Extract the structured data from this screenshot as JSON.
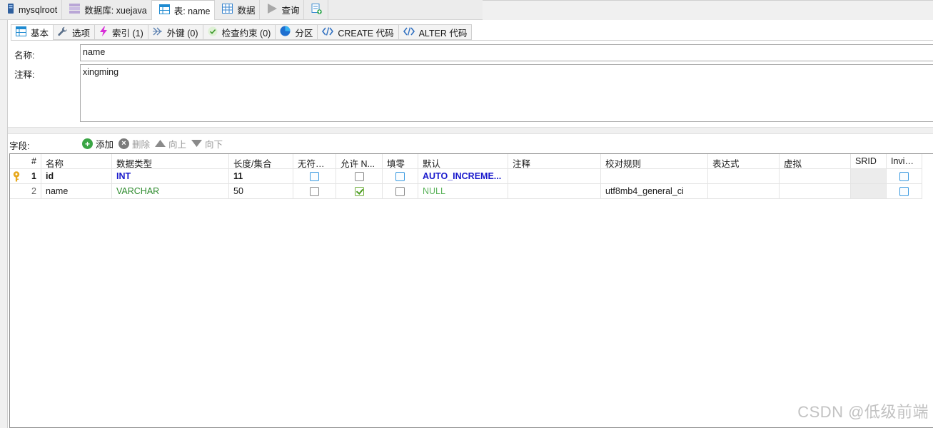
{
  "top_tabs": [
    {
      "label": "mysqlroot",
      "icon": "server-icon"
    },
    {
      "label": "数据库: xuejava",
      "icon": "database-icon"
    },
    {
      "label": "表: name",
      "icon": "table-icon",
      "active": true
    },
    {
      "label": "数据",
      "icon": "grid-icon"
    },
    {
      "label": "查询",
      "icon": "play-icon"
    },
    {
      "label": "",
      "icon": "new-query-icon"
    }
  ],
  "sub_tabs": [
    {
      "label": "基本",
      "icon": "table-icon",
      "active": true
    },
    {
      "label": "选项",
      "icon": "wrench-icon"
    },
    {
      "label": "索引 (1)",
      "icon": "lightning-icon"
    },
    {
      "label": "外键 (0)",
      "icon": "foreign-key-icon"
    },
    {
      "label": "检查约束 (0)",
      "icon": "check-icon"
    },
    {
      "label": "分区",
      "icon": "partition-icon"
    },
    {
      "label": "CREATE 代码",
      "icon": "code-icon"
    },
    {
      "label": "ALTER 代码",
      "icon": "code-icon"
    }
  ],
  "form": {
    "name_label": "名称:",
    "name_value": "name",
    "comment_label": "注释:",
    "comment_value": "xingming"
  },
  "fields_toolbar": {
    "label": "字段:",
    "add": "添加",
    "delete": "删除",
    "up": "向上",
    "down": "向下"
  },
  "columns": [
    "#",
    "名称",
    "数据类型",
    "长度/集合",
    "无符号的",
    "允许 N...",
    "填零",
    "默认",
    "注释",
    "校对规则",
    "表达式",
    "虚拟",
    "SRID",
    "Invisi..."
  ],
  "rows": [
    {
      "num": "1",
      "name": "id",
      "type": "INT",
      "length": "11",
      "unsigned": false,
      "allow_null": false,
      "zerofill": false,
      "default": "AUTO_INCREME...",
      "comment": "",
      "collation": "",
      "expression": "",
      "virtual": "",
      "srid": "",
      "invisible": false,
      "primary_key": true
    },
    {
      "num": "2",
      "name": "name",
      "type": "VARCHAR",
      "length": "50",
      "unsigned": false,
      "allow_null": true,
      "zerofill": false,
      "default": "NULL",
      "comment": "",
      "collation": "utf8mb4_general_ci",
      "expression": "",
      "virtual": "",
      "srid": "",
      "invisible": false,
      "primary_key": false
    }
  ],
  "watermark": "CSDN @低级前端",
  "colors": {
    "int_type": "#1a1acc",
    "varchar_type": "#2e8b2e",
    "auto_increment": "#1a1acc",
    "null_default": "#5bb35b",
    "key_icon": "#e7a81c"
  }
}
